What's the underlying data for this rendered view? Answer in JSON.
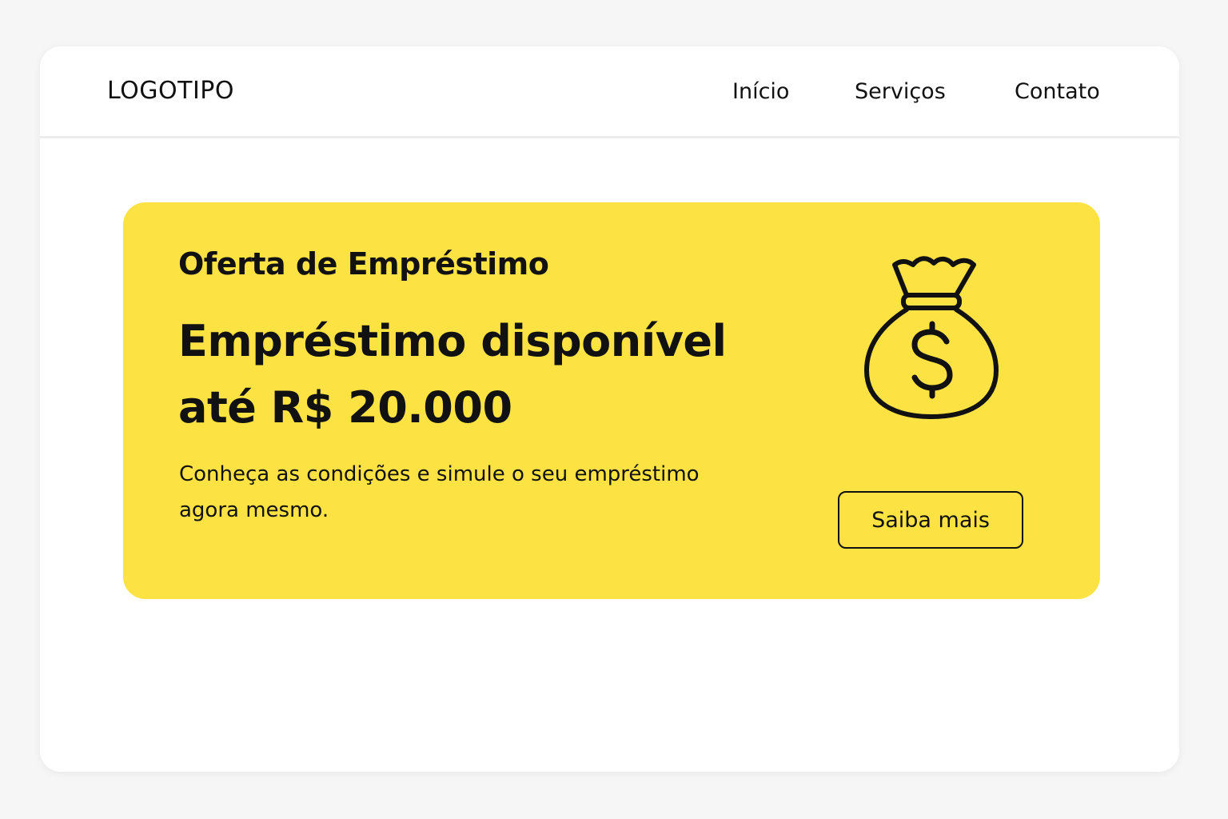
{
  "header": {
    "logo": "LOGOTIPO",
    "nav": [
      {
        "label": "Início"
      },
      {
        "label": "Serviços"
      },
      {
        "label": "Contato"
      }
    ]
  },
  "offer": {
    "eyebrow": "Oferta de Empréstimo",
    "headline_line1": "Empréstimo disponível",
    "headline_line2": "até R$ 20.000",
    "description_line1": "Conheça as condições e simule o seu empréstimo",
    "description_line2": "agora mesmo.",
    "button_label": "Saiba mais",
    "icon": "money-bag-icon",
    "background_color": "#fde243"
  }
}
